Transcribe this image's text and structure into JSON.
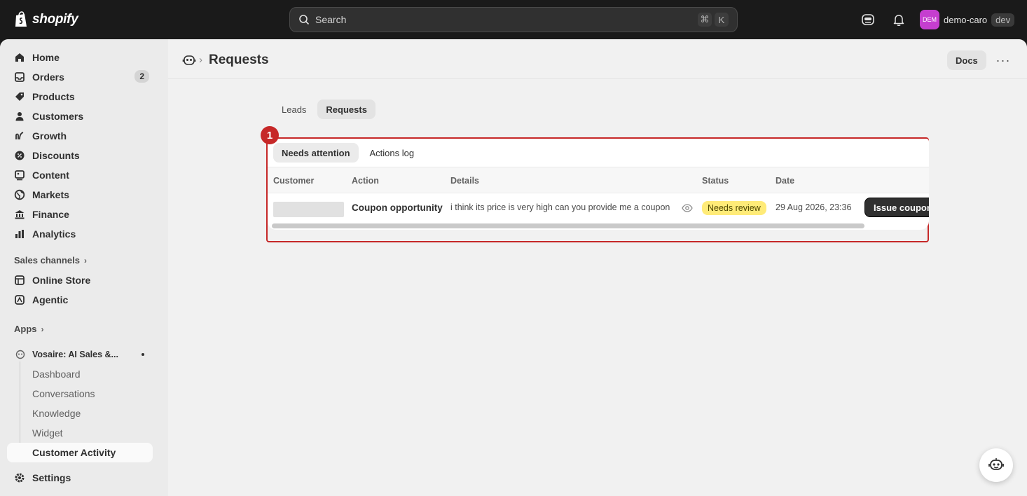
{
  "topbar": {
    "logo_text": "shopify",
    "search_placeholder": "Search",
    "shortcut_cmd": "⌘",
    "shortcut_key": "K",
    "avatar_initials": "DEM",
    "store_name": "demo-caro",
    "store_badge": "dev"
  },
  "sidebar": {
    "items": [
      {
        "label": "Home",
        "icon": "home-icon"
      },
      {
        "label": "Orders",
        "icon": "orders-icon",
        "badge": "2"
      },
      {
        "label": "Products",
        "icon": "tag-icon"
      },
      {
        "label": "Customers",
        "icon": "person-icon"
      },
      {
        "label": "Growth",
        "icon": "growth-icon"
      },
      {
        "label": "Discounts",
        "icon": "discount-icon"
      },
      {
        "label": "Content",
        "icon": "content-icon"
      },
      {
        "label": "Markets",
        "icon": "globe-icon"
      },
      {
        "label": "Finance",
        "icon": "bank-icon"
      },
      {
        "label": "Analytics",
        "icon": "chart-icon"
      }
    ],
    "sales_channels_label": "Sales channels",
    "channels": [
      {
        "label": "Online Store",
        "icon": "store-icon"
      },
      {
        "label": "Agentic",
        "icon": "agentic-icon"
      }
    ],
    "apps_label": "Apps",
    "app_name": "Vosaire: AI Sales &...",
    "app_subitems": [
      "Dashboard",
      "Conversations",
      "Knowledge",
      "Widget",
      "Customer Activity"
    ],
    "settings_label": "Settings"
  },
  "header": {
    "title": "Requests",
    "docs_label": "Docs",
    "more_label": "···"
  },
  "tabs": [
    "Leads",
    "Requests"
  ],
  "card": {
    "marker": "1",
    "subtabs": [
      "Needs attention",
      "Actions log"
    ],
    "columns": [
      "Customer",
      "Action",
      "Details",
      "Status",
      "Date"
    ],
    "rows": [
      {
        "action": "Coupon opportunity",
        "details": "i think its price is very high can you provide me a coupon",
        "status": "Needs review",
        "date": "29 Aug 2026, 23:36",
        "button": "Issue coupon"
      }
    ]
  },
  "colors": {
    "accent_red": "#c62828",
    "status_yellow": "#ffeb78",
    "avatar_magenta": "#c53ecf"
  }
}
